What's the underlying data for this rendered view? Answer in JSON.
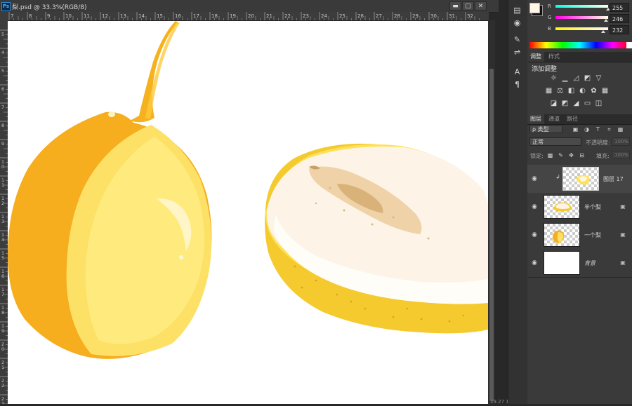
{
  "document": {
    "title": "梨.psd @ 33.3%(RGB/8)",
    "app_icon_text": "Ps",
    "window_buttons": [
      "▬",
      "▢",
      "✕"
    ],
    "ruler_h_labels": [
      "7",
      "8",
      "9",
      "10",
      "11",
      "12",
      "13",
      "14",
      "15",
      "16",
      "17",
      "18",
      "19",
      "20",
      "21",
      "22",
      "23",
      "24",
      "25",
      "26",
      "27",
      "28",
      "29",
      "30",
      "31",
      "32"
    ],
    "ruler_v_labels": [
      "5",
      "4",
      "5",
      "6",
      "7",
      "8",
      "9",
      "1 0",
      "1 1",
      "1 2",
      "1 3",
      "1 4",
      "1 5",
      "1 6",
      "1 7",
      "1 8",
      "1 9",
      "2 0",
      "2 1",
      "2 2",
      "2 3"
    ],
    "status": "29.27 14.5"
  },
  "color_panel": {
    "foreground": "#fff6e8",
    "channels": [
      {
        "label": "R",
        "value": "255",
        "gradient": [
          "#00ffe8",
          "#ffffe8"
        ],
        "level": 1.0
      },
      {
        "label": "G",
        "value": "246",
        "gradient": [
          "#ff00e8",
          "#ffffe8"
        ],
        "level": 0.96
      },
      {
        "label": "B",
        "value": "232",
        "gradient": [
          "#fff600",
          "#fff6ff"
        ],
        "level": 0.91
      }
    ]
  },
  "adjustments": {
    "tabs": [
      "调整",
      "样式"
    ],
    "heading": "添加调整"
  },
  "layers": {
    "tabs": [
      "图层",
      "通道",
      "路径"
    ],
    "filter_label": "ρ 类型",
    "blend_mode": "正常",
    "opacity_label": "不透明度:",
    "opacity_value": "100%",
    "lock_label": "锁定:",
    "fill_label": "填充:",
    "fill_value": "100%",
    "items": [
      {
        "name": "图层 17",
        "clipped": true,
        "selected": true
      },
      {
        "name": "半个梨",
        "clipped": false,
        "selected": false
      },
      {
        "name": "一个梨",
        "clipped": false,
        "selected": false
      },
      {
        "name": "背景",
        "clipped": false,
        "selected": false
      }
    ]
  }
}
